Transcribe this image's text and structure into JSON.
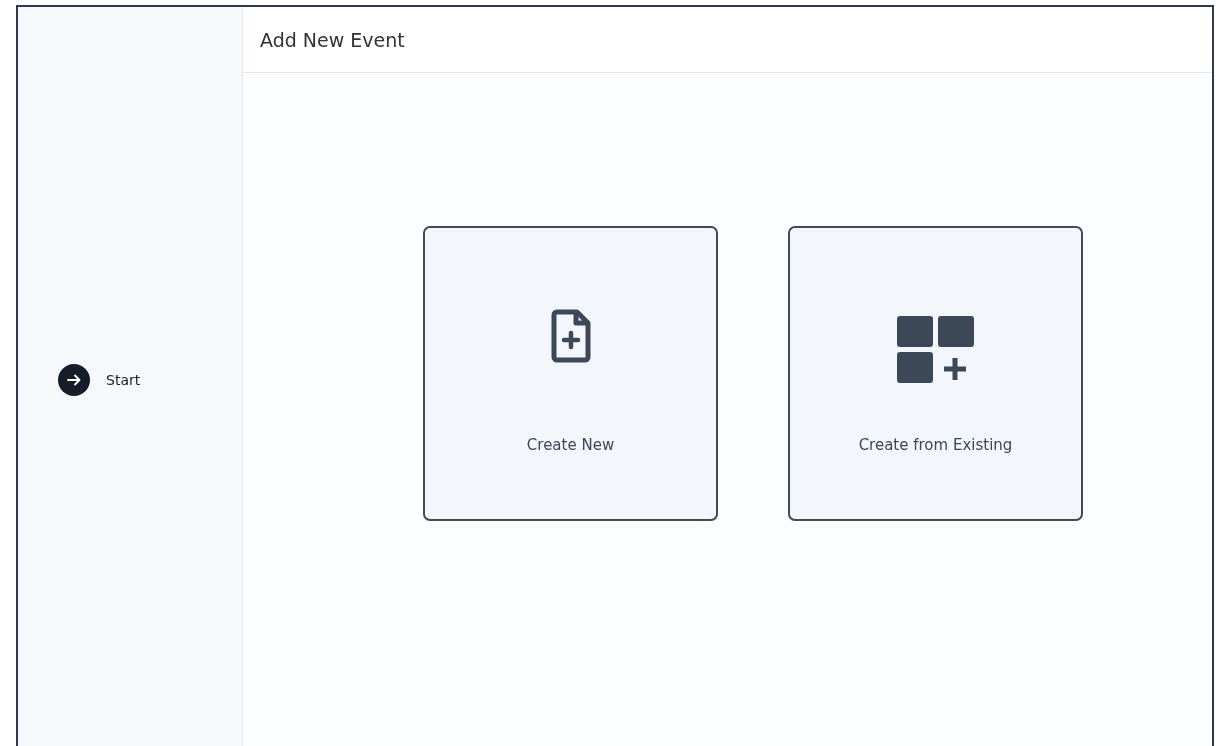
{
  "sidebar": {
    "steps": [
      {
        "label": "Start",
        "selected": true
      }
    ]
  },
  "header": {
    "title": "Add New Event"
  },
  "options": [
    {
      "kind": "new",
      "label": "Create New"
    },
    {
      "kind": "existing",
      "label": "Create from Existing"
    }
  ]
}
